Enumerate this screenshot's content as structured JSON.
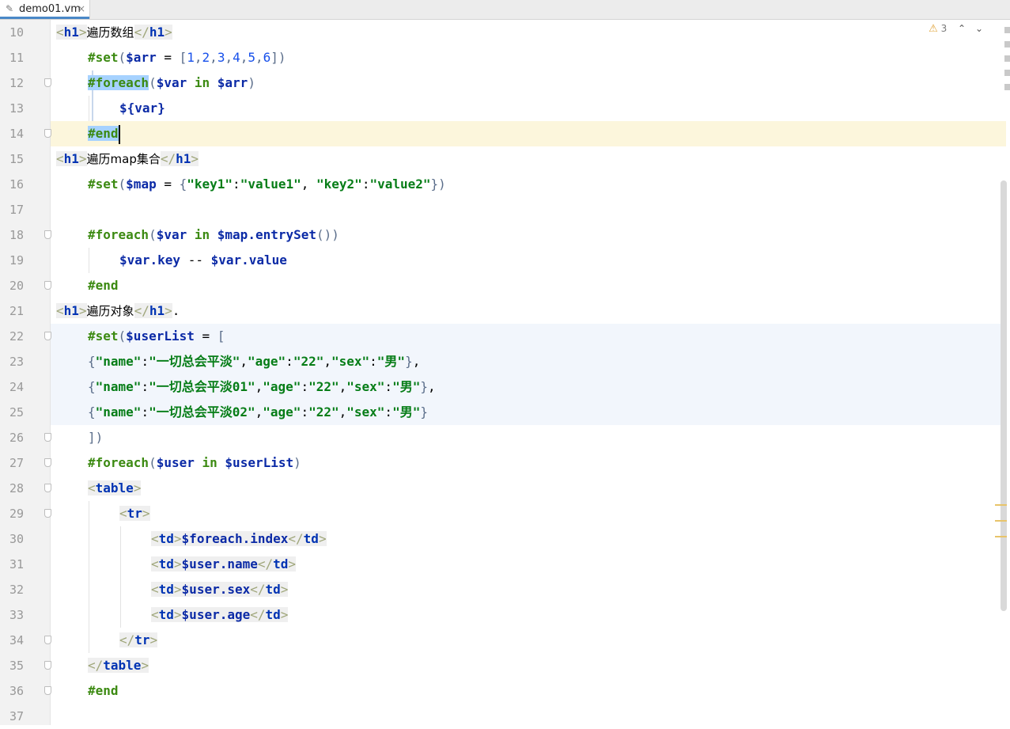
{
  "tab": {
    "icon": "file-icon",
    "name": "demo01.vm",
    "close": "×"
  },
  "inspections": {
    "icon": "warning-icon",
    "glyph": "⚠",
    "count": "3",
    "prev": "⌃",
    "next": "⌄"
  },
  "lines": [
    {
      "no": "10"
    },
    {
      "no": "11"
    },
    {
      "no": "12"
    },
    {
      "no": "13"
    },
    {
      "no": "14"
    },
    {
      "no": "15"
    },
    {
      "no": "16"
    },
    {
      "no": "17"
    },
    {
      "no": "18"
    },
    {
      "no": "19"
    },
    {
      "no": "20"
    },
    {
      "no": "21"
    },
    {
      "no": "22"
    },
    {
      "no": "23"
    },
    {
      "no": "24"
    },
    {
      "no": "25"
    },
    {
      "no": "26"
    },
    {
      "no": "27"
    },
    {
      "no": "28"
    },
    {
      "no": "29"
    },
    {
      "no": "30"
    },
    {
      "no": "31"
    },
    {
      "no": "32"
    },
    {
      "no": "33"
    },
    {
      "no": "34"
    },
    {
      "no": "35"
    },
    {
      "no": "36"
    },
    {
      "no": "37"
    }
  ],
  "code": {
    "h1": "h1",
    "l10_text": "遍历数组",
    "set": "#set",
    "foreach": "#foreach",
    "end": "#end",
    "in": "in",
    "arr": "$arr",
    "var": "$var",
    "l11_vals": [
      "1",
      "2",
      "3",
      "4",
      "5",
      "6"
    ],
    "l13_expr": "${var}",
    "l15_text": "遍历map集合",
    "map": "$map",
    "key1": "\"key1\"",
    "value1": "\"value1\"",
    "key2": "\"key2\"",
    "value2": "\"value2\"",
    "entrySet": ".entrySet",
    "l19_key": "$var.key",
    "l19_sep": "--",
    "l19_val": "$var.value",
    "l21_text": "遍历对象",
    "userList": "$userList",
    "name_k": "\"name\"",
    "age_k": "\"age\"",
    "sex_k": "\"sex\"",
    "name_v1": "\"一切总会平淡\"",
    "name_v2": "\"一切总会平淡01\"",
    "name_v3": "\"一切总会平淡02\"",
    "age_v": "\"22\"",
    "sex_v": "\"男\"",
    "user": "$user",
    "table": "table",
    "tr": "tr",
    "td": "td",
    "f_index": "$foreach.index",
    "u_name": "$user.name",
    "u_sex": "$user.sex",
    "u_age": "$user.age"
  },
  "colors": {
    "keyword": "#3c8a12",
    "variable": "#0b2aa6",
    "number": "#1750eb",
    "string": "#067d17",
    "tag": "#0033b3",
    "current_line": "#fcf6dc",
    "selection": "#a6d2ff"
  }
}
